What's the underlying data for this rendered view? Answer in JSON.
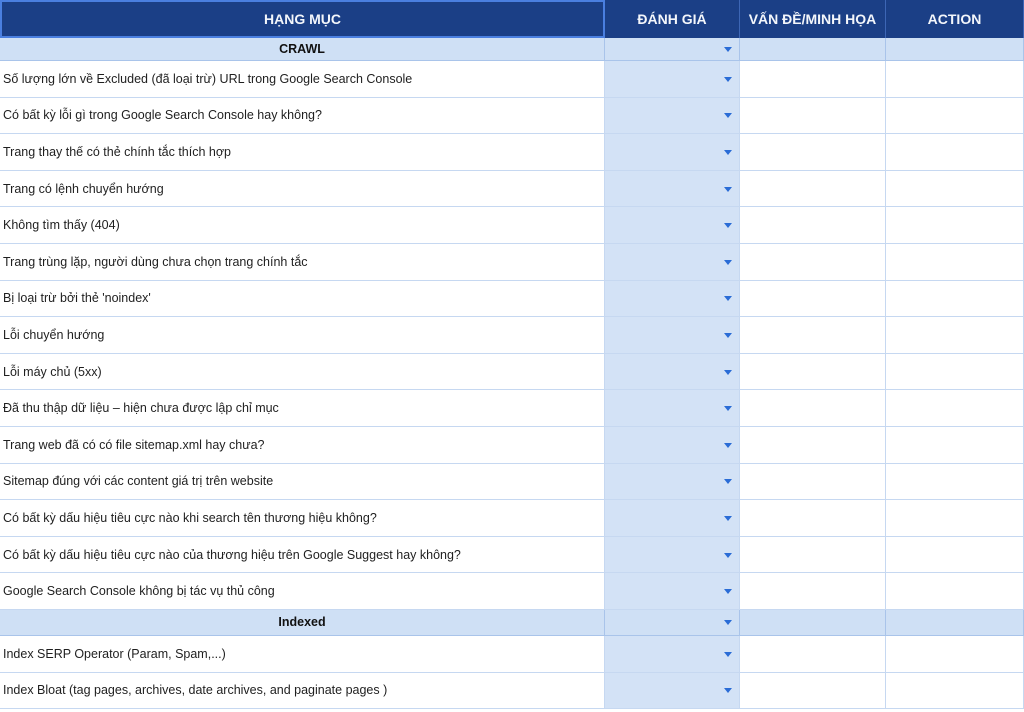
{
  "columns": [
    "HẠNG MỤC",
    "ĐÁNH GIÁ",
    "VẤN ĐỀ/MINH HỌA",
    "ACTION"
  ],
  "sections": [
    {
      "title": "CRAWL",
      "items": [
        "Số lượng lớn về Excluded (đã loại trừ) URL trong Google Search Console",
        "Có bất kỳ lỗi gì trong Google Search Console hay không?",
        "Trang thay thế có thẻ chính tắc thích hợp",
        "Trang có lệnh chuyển hướng",
        "Không tìm thấy (404)",
        "Trang trùng lặp, người dùng chưa chọn trang chính tắc",
        "Bị loại trừ bởi thẻ 'noindex'",
        "Lỗi chuyển hướng",
        "Lỗi máy chủ (5xx)",
        "Đã thu thập dữ liệu – hiện chưa được lập chỉ mục",
        "Trang web đã có có file sitemap.xml hay chưa?",
        "Sitemap đúng với các content giá trị trên website",
        "Có bất kỳ dấu hiệu tiêu cực nào khi search tên thương hiệu không?",
        "Có bất kỳ dấu hiệu tiêu cực nào của thương hiệu trên Google Suggest hay không?",
        "Google Search Console không bị tác vụ thủ công"
      ]
    },
    {
      "title": "Indexed",
      "items": [
        "Index SERP Operator (Param, Spam,...)",
        "Index Bloat (tag pages, archives, date archives, and paginate pages )"
      ]
    }
  ]
}
